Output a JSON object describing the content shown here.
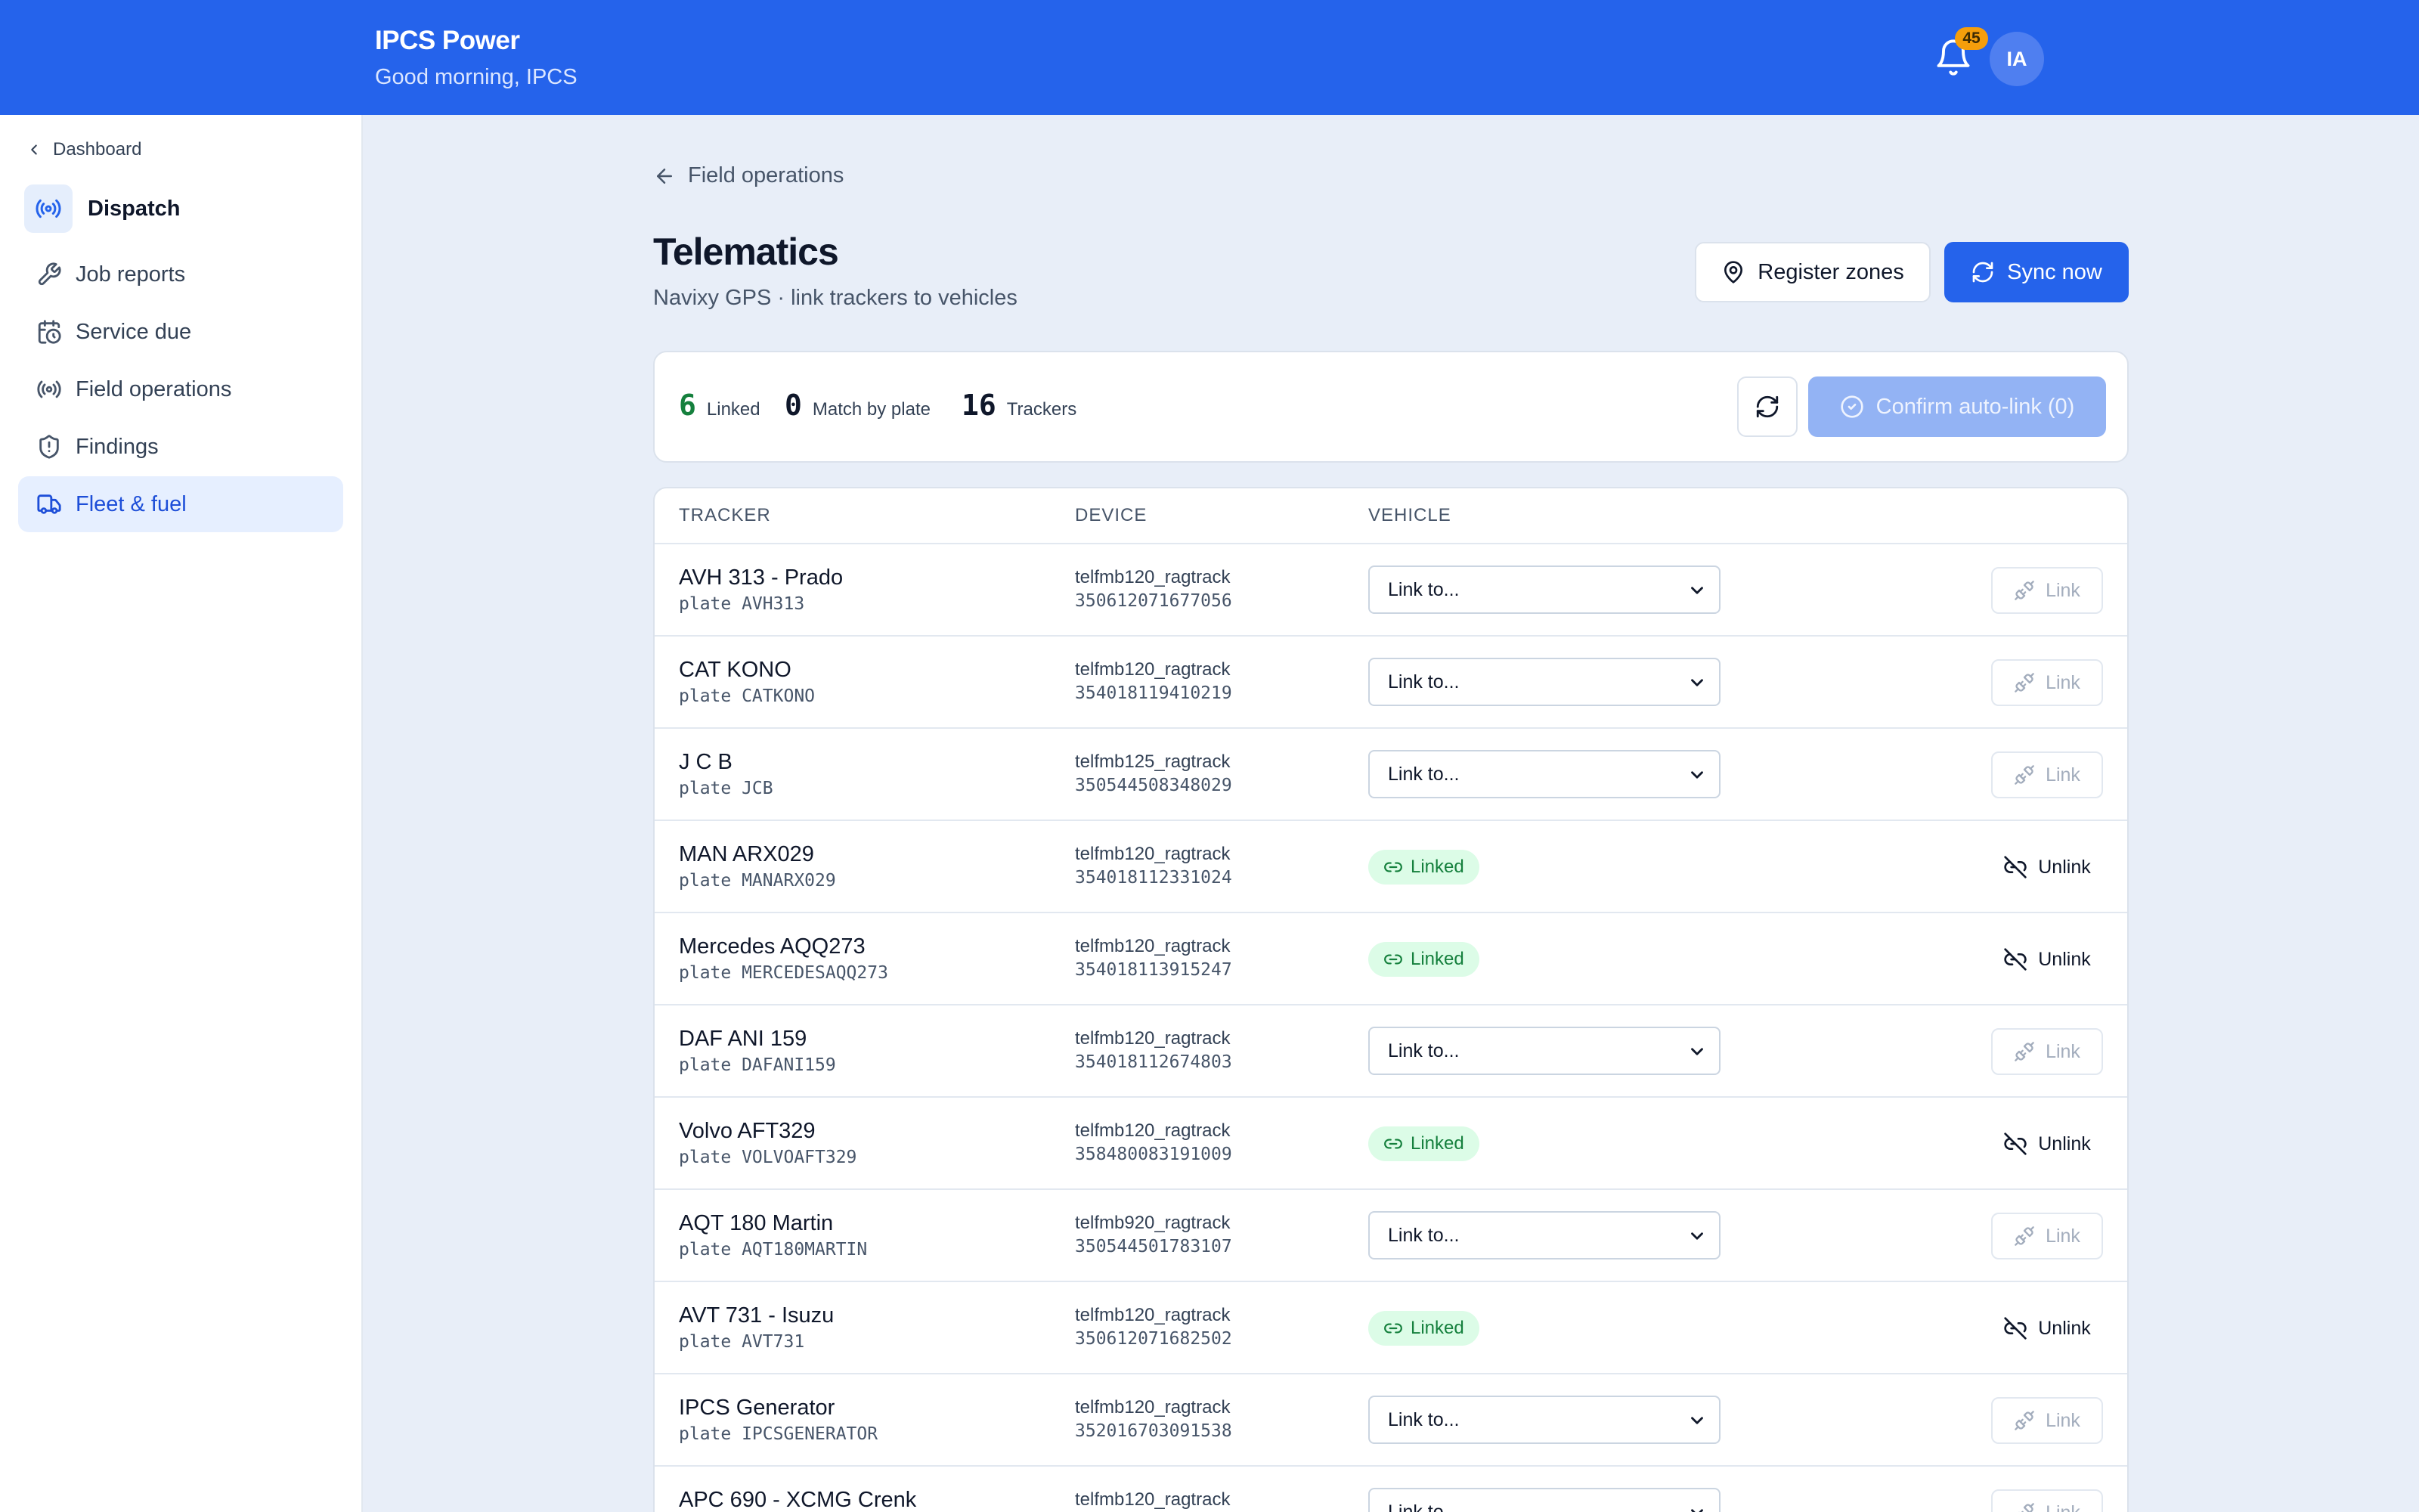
{
  "header": {
    "brand": "IPCS Power",
    "greeting": "Good morning, IPCS",
    "notification_count": "45",
    "avatar_initials": "IA",
    "brand_color": "#2563eb"
  },
  "sidebar": {
    "back_label": "Dashboard",
    "section_title": "Dispatch",
    "items": [
      {
        "label": "Job reports",
        "icon": "wrench-icon"
      },
      {
        "label": "Service due",
        "icon": "calendar-clock-icon"
      },
      {
        "label": "Field operations",
        "icon": "radio-icon"
      },
      {
        "label": "Findings",
        "icon": "shield-alert-icon"
      },
      {
        "label": "Fleet & fuel",
        "icon": "truck-icon",
        "active": true
      }
    ]
  },
  "page": {
    "breadcrumb": "Field operations",
    "title": "Telematics",
    "subtitle": "Navixy GPS · link trackers to vehicles",
    "register_zones_label": "Register zones",
    "sync_now_label": "Sync now"
  },
  "summary": {
    "linked_count": "6",
    "linked_label": "Linked",
    "match_count": "0",
    "match_label": "Match by plate",
    "trackers_count": "16",
    "trackers_label": "Trackers",
    "confirm_label": "Confirm auto-link (0)"
  },
  "table": {
    "columns": [
      "TRACKER",
      "DEVICE",
      "VEHICLE"
    ],
    "select_placeholder": "Link to...",
    "linked_badge": "Linked",
    "link_label": "Link",
    "unlink_label": "Unlink",
    "rows": [
      {
        "name": "AVH 313 - Prado",
        "plate": "plate AVH313",
        "model": "telfmb120_ragtrack",
        "imei": "350612071677056",
        "status": "unlinked"
      },
      {
        "name": "CAT KONO",
        "plate": "plate CATKONO",
        "model": "telfmb120_ragtrack",
        "imei": "354018119410219",
        "status": "unlinked"
      },
      {
        "name": "J C B",
        "plate": "plate JCB",
        "model": "telfmb125_ragtrack",
        "imei": "350544508348029",
        "status": "unlinked"
      },
      {
        "name": "MAN ARX029",
        "plate": "plate MANARX029",
        "model": "telfmb120_ragtrack",
        "imei": "354018112331024",
        "status": "linked"
      },
      {
        "name": "Mercedes AQQ273",
        "plate": "plate MERCEDESAQQ273",
        "model": "telfmb120_ragtrack",
        "imei": "354018113915247",
        "status": "linked"
      },
      {
        "name": "DAF ANI 159",
        "plate": "plate DAFANI159",
        "model": "telfmb120_ragtrack",
        "imei": "354018112674803",
        "status": "unlinked"
      },
      {
        "name": "Volvo AFT329",
        "plate": "plate VOLVOAFT329",
        "model": "telfmb120_ragtrack",
        "imei": "358480083191009",
        "status": "linked"
      },
      {
        "name": "AQT 180 Martin",
        "plate": "plate AQT180MARTIN",
        "model": "telfmb920_ragtrack",
        "imei": "350544501783107",
        "status": "unlinked"
      },
      {
        "name": "AVT 731 - Isuzu",
        "plate": "plate AVT731",
        "model": "telfmb120_ragtrack",
        "imei": "350612071682502",
        "status": "linked"
      },
      {
        "name": "IPCS Generator",
        "plate": "plate IPCSGENERATOR",
        "model": "telfmb120_ragtrack",
        "imei": "352016703091538",
        "status": "unlinked"
      },
      {
        "name": "APC 690 - XCMG Crenk",
        "plate": "",
        "model": "telfmb120_ragtrack",
        "imei": "",
        "status": "unlinked"
      }
    ]
  }
}
